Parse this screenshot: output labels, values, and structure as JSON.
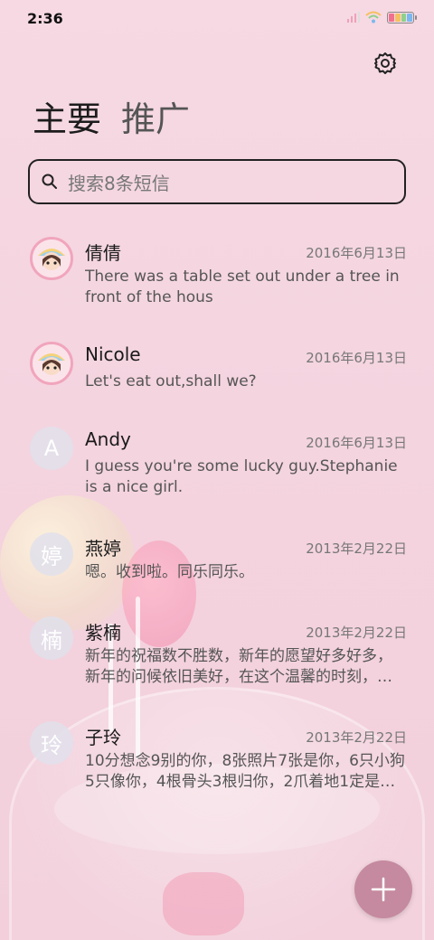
{
  "status_bar": {
    "time": "2:36",
    "battery_colors": [
      "#f07090",
      "#f5c060",
      "#8fd08a",
      "#7ab8f0"
    ]
  },
  "header": {
    "tab_primary": "主要",
    "tab_promo": "推广",
    "settings_icon": "gear-icon"
  },
  "search": {
    "placeholder": "搜索8条短信",
    "icon": "search-icon"
  },
  "conversations": [
    {
      "name": "倩倩",
      "date": "2016年6月13日",
      "preview": "There was a table set out under a tree in front of the hous",
      "avatar_type": "photo"
    },
    {
      "name": "Nicole",
      "date": "2016年6月13日",
      "preview": "Let's eat out,shall we?",
      "avatar_type": "photo"
    },
    {
      "name": "Andy",
      "date": "2016年6月13日",
      "preview": "I guess you're some lucky guy.Stephanie is a nice girl.",
      "avatar_type": "letter",
      "avatar_letter": "A"
    },
    {
      "name": "燕婷",
      "date": "2013年2月22日",
      "preview": "嗯。收到啦。同乐同乐。",
      "avatar_type": "letter",
      "avatar_letter": "婷"
    },
    {
      "name": "紫楠",
      "date": "2013年2月22日",
      "preview": "新年的祝福数不胜数，新年的愿望好多好多，新年的问候依旧美好，在这个温馨的时刻，…",
      "avatar_type": "letter",
      "avatar_letter": "楠"
    },
    {
      "name": "子玲",
      "date": "2013年2月22日",
      "preview": "10分想念9别的你，8张照片7张是你，6只小狗5只像你，4根骨头3根归你，2爪着地1定是…",
      "avatar_type": "letter",
      "avatar_letter": "玲"
    }
  ],
  "fab": {
    "icon": "plus-icon",
    "color": "#c58a9f"
  }
}
